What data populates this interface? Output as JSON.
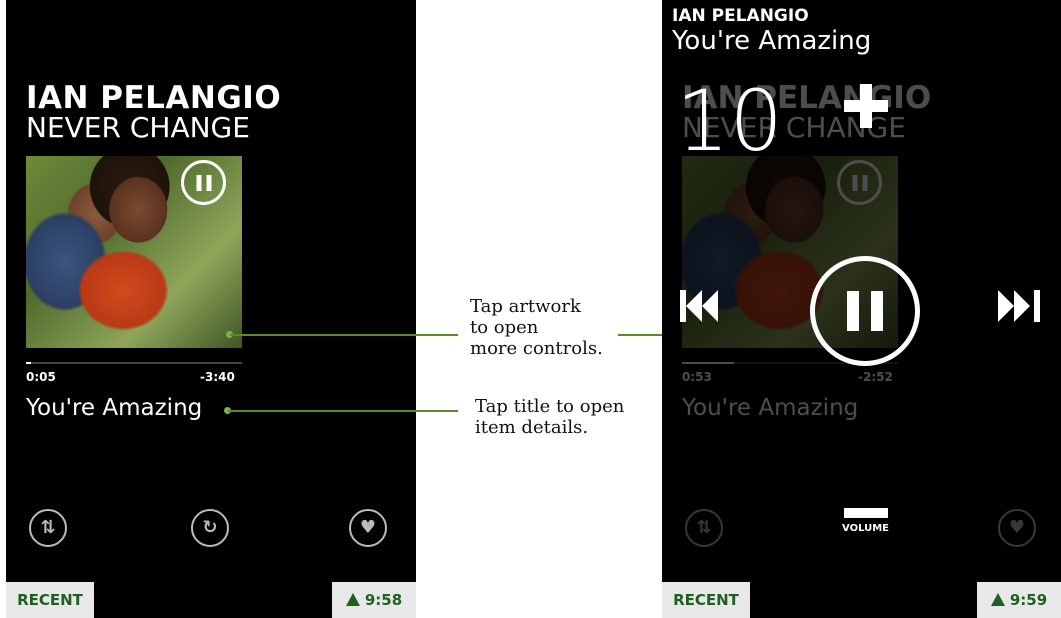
{
  "left_screen": {
    "artist": "IAN PELANGIO",
    "album": "NEVER CHANGE",
    "elapsed": "0:05",
    "remaining": "-3:40",
    "progress": 0.025,
    "song_title": "You're Amazing",
    "recent_label": "RECENT",
    "clock": "9:58"
  },
  "right_screen": {
    "artist": "IAN PELANGIO",
    "song_title_header": "You're Amazing",
    "bg_artist": "IAN PELANGIO",
    "bg_album": "NEVER CHANGE",
    "volume_value": "10",
    "volume_label": "VOLUME",
    "elapsed": "0:53",
    "remaining": "-2:52",
    "progress": 0.24,
    "song_title": "You're Amazing",
    "recent_label": "RECENT",
    "clock": "9:59"
  },
  "callouts": {
    "artwork": [
      "Tap artwork",
      "to open",
      "more controls."
    ],
    "title": [
      "Tap title to open",
      "item details."
    ]
  },
  "colors": {
    "accent_green": "#7cb342",
    "tray_text": "#1f5f1f",
    "tray_bg": "#e8e8e8"
  },
  "icons": {
    "left_icon": "shuffle-icon",
    "center_icon": "repeat-icon",
    "right_icon": "heart-icon"
  }
}
